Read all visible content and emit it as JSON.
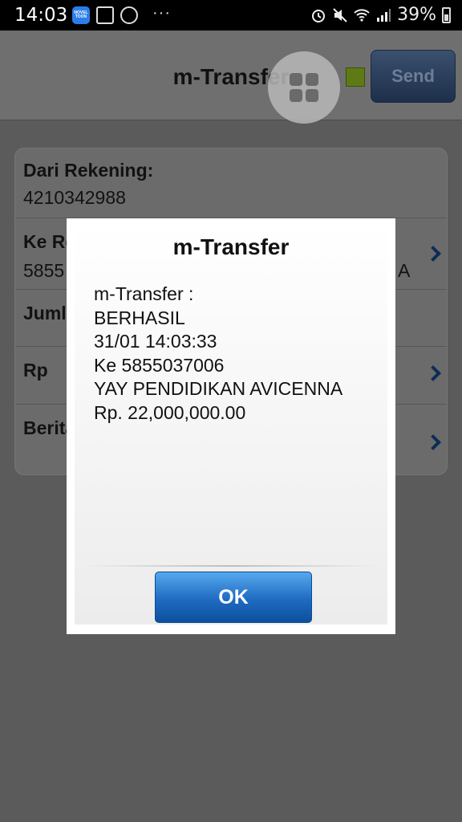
{
  "status_bar": {
    "time": "14:03",
    "novel_app_label": "NOVEL TOON",
    "more_indicator": "···",
    "battery_percent": "39%",
    "icons": [
      "novel-toon-app-icon",
      "gallery-icon",
      "messenger-icon",
      "alarm-icon",
      "mute-icon",
      "wifi-icon",
      "signal-icon",
      "battery-icon"
    ]
  },
  "header": {
    "title": "m-Transfer",
    "send_label": "Send",
    "status_color": "#5d7a16"
  },
  "form": {
    "rows": [
      {
        "label": "Dari Rekening:",
        "value": "4210342988"
      },
      {
        "label": "Ke Re",
        "value": "5855",
        "extra": "A"
      },
      {
        "label": "Juml"
      },
      {
        "label": "Rp"
      },
      {
        "label": "Berita"
      }
    ]
  },
  "dialog": {
    "title": "m-Transfer",
    "lines": [
      "m-Transfer :",
      "BERHASIL",
      "31/01 14:03:33",
      "Ke 5855037006",
      "YAY PENDIDIKAN AVICENNA",
      "Rp. 22,000,000.00"
    ],
    "ok_label": "OK",
    "ok_color": "#1f6bc2"
  }
}
